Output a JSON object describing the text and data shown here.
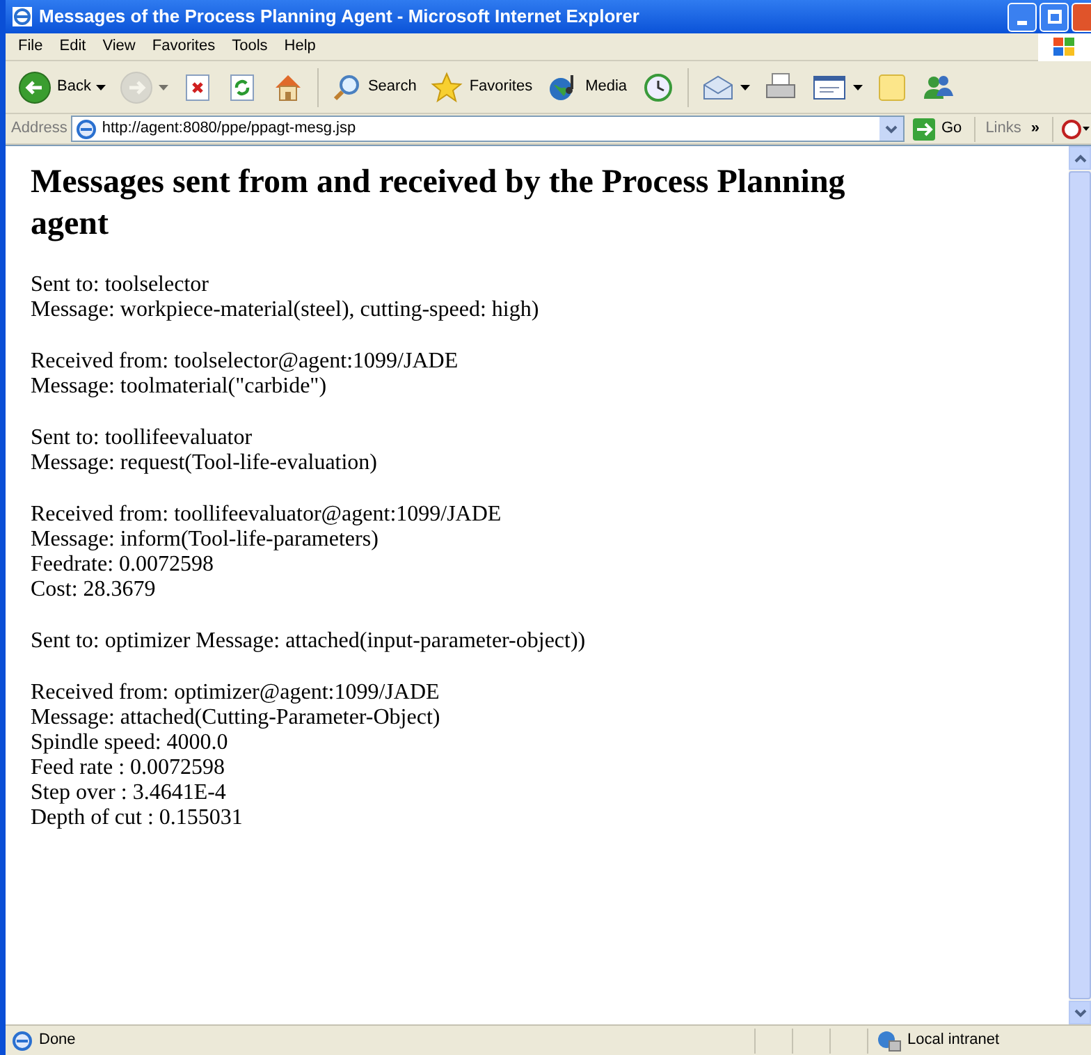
{
  "window": {
    "title": "Messages of the Process Planning Agent - Microsoft Internet Explorer"
  },
  "menu": [
    "File",
    "Edit",
    "View",
    "Favorites",
    "Tools",
    "Help"
  ],
  "toolbar": [
    {
      "label": "Back",
      "dropdown": true,
      "disabled": false
    },
    {
      "dropdown": true,
      "disabled": true
    },
    {
      "dropdown": false,
      "disabled": false
    },
    {
      "dropdown": false,
      "disabled": false
    },
    {
      "dropdown": false,
      "disabled": false
    },
    {
      "label": "Search",
      "dropdown": false,
      "disabled": false
    },
    {
      "label": "Favorites",
      "dropdown": false,
      "disabled": false
    },
    {
      "label": "Media",
      "dropdown": false,
      "disabled": false
    },
    {
      "dropdown": false,
      "disabled": false
    },
    {
      "dropdown": true,
      "disabled": false
    },
    {
      "dropdown": false,
      "disabled": false
    },
    {
      "dropdown": true,
      "disabled": false
    },
    {
      "dropdown": false,
      "disabled": false
    },
    {
      "dropdown": false,
      "disabled": false
    }
  ],
  "address": {
    "label": "Address",
    "url": "http://agent:8080/ppe/ppagt-mesg.jsp",
    "go": "Go",
    "links": "Links",
    "chevron": "»"
  },
  "page": {
    "heading": "Messages sent from and received by the Process Planning agent",
    "blocks": [
      [
        "Sent to: toolselector",
        "Message: workpiece-material(steel), cutting-speed: high)"
      ],
      [
        "Received from: toolselector@agent:1099/JADE",
        "Message: toolmaterial(\"carbide\")"
      ],
      [
        "Sent to: toollifeevaluator",
        "Message: request(Tool-life-evaluation)"
      ],
      [
        "Received from: toollifeevaluator@agent:1099/JADE",
        "Message: inform(Tool-life-parameters)",
        "Feedrate: 0.0072598",
        "Cost: 28.3679"
      ],
      [
        "Sent to: optimizer Message: attached(input-parameter-object))"
      ],
      [
        "Received from: optimizer@agent:1099/JADE",
        "Message: attached(Cutting-Parameter-Object)",
        "Spindle speed: 4000.0",
        "Feed rate : 0.0072598",
        "Step over : 3.4641E-4",
        "Depth of cut : 0.155031"
      ]
    ]
  },
  "status_bar": {
    "text": "Done",
    "zone": "Local intranet"
  }
}
